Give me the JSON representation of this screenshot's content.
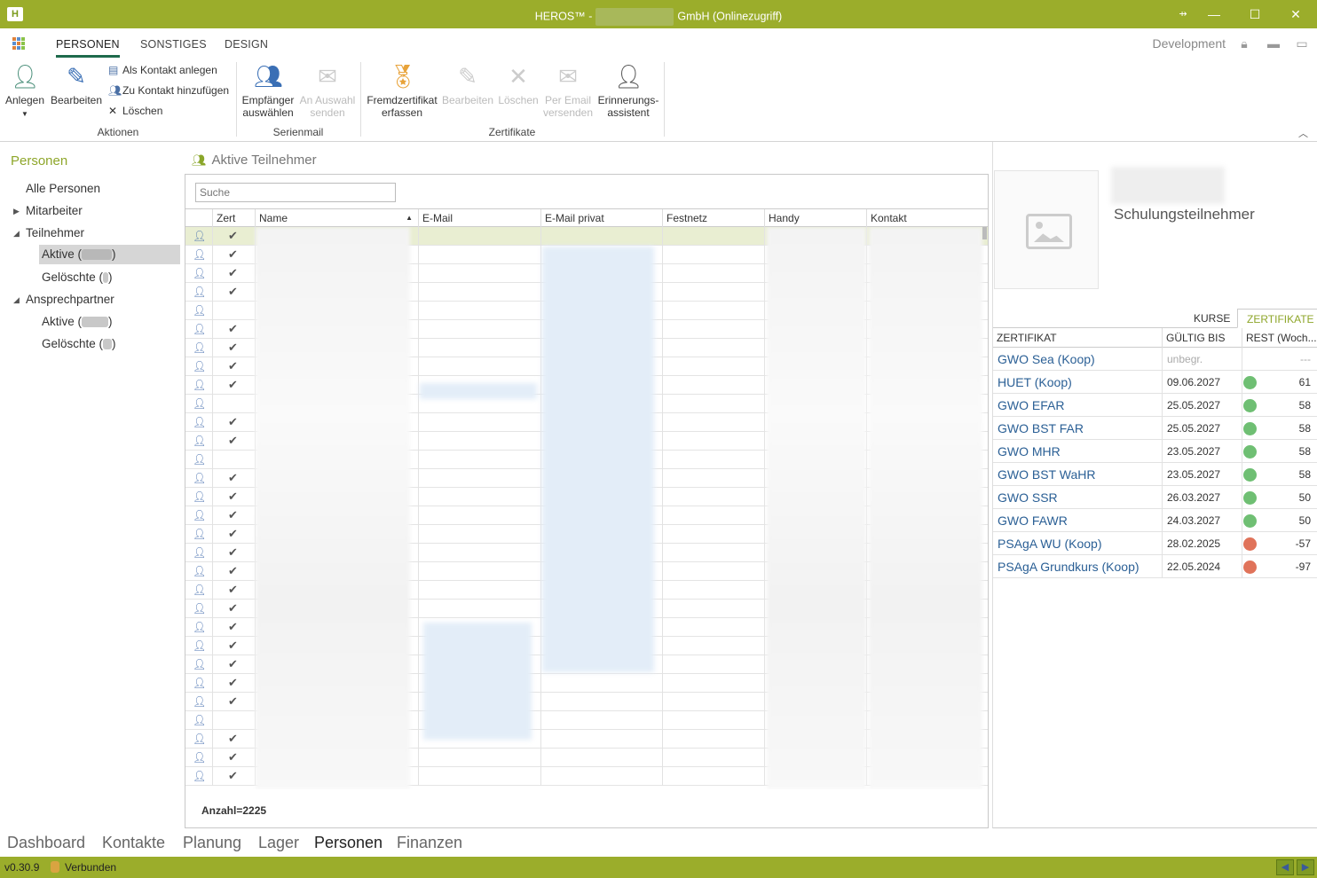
{
  "window": {
    "title_left": "HEROS™ -",
    "title_right": "GmbH (Onlinezugriff)",
    "logo": "H",
    "pin": "⇸",
    "min": "—",
    "max": "☐",
    "close": "✕"
  },
  "tabs": [
    "PERSONEN",
    "SONSTIGES",
    "DESIGN"
  ],
  "topright": {
    "env": "Development"
  },
  "ribbon": {
    "anlegen": "Anlegen",
    "bearbeiten": "Bearbeiten",
    "als_kontakt": "Als Kontakt anlegen",
    "zu_kontakt": "Zu Kontakt hinzufügen",
    "loeschen": "Löschen",
    "group_aktionen": "Aktionen",
    "empf1": "Empfänger",
    "empf2": "auswählen",
    "an1": "An Auswahl",
    "an2": "senden",
    "group_serienmail": "Serienmail",
    "fremd1": "Fremdzertifikat",
    "fremd2": "erfassen",
    "z_bearbeiten": "Bearbeiten",
    "z_loeschen": "Löschen",
    "mail1": "Per Email",
    "mail2": "versenden",
    "erin1": "Erinnerungs-",
    "erin2": "assistent",
    "group_zertifikate": "Zertifikate"
  },
  "sidebar": {
    "heading": "Personen",
    "items": [
      {
        "label": "Alle Personen"
      },
      {
        "label": "Mitarbeiter"
      },
      {
        "label": "Teilnehmer"
      },
      {
        "label": "Aktive ("
      },
      {
        "label": "Gelöschte ("
      },
      {
        "label": "Ansprechpartner"
      },
      {
        "label": "Aktive ("
      },
      {
        "label": "Gelöschte ("
      }
    ],
    "close_paren": ")"
  },
  "main": {
    "title": "Aktive Teilnehmer",
    "search_placeholder": "Suche",
    "columns": [
      "Zert",
      "Name",
      "E-Mail",
      "E-Mail privat",
      "Festnetz",
      "Handy",
      "Kontakt"
    ],
    "count": "Anzahl=2225",
    "zert": [
      1,
      1,
      1,
      1,
      0,
      1,
      1,
      1,
      1,
      0,
      1,
      1,
      0,
      1,
      1,
      1,
      1,
      1,
      1,
      1,
      1,
      1,
      1,
      1,
      1,
      1,
      0,
      1,
      1,
      1
    ]
  },
  "right": {
    "role": "Schulungsteilnehmer",
    "tabs": [
      "KURSE",
      "ZERTIFIKATE"
    ],
    "headers": [
      "ZERTIFIKAT",
      "GÜLTIG BIS",
      "REST (Woch..."
    ],
    "certs": [
      {
        "name": "GWO Sea (Koop)",
        "date": "unbegr.",
        "rest": "---",
        "status": "none"
      },
      {
        "name": "HUET (Koop)",
        "date": "09.06.2027",
        "rest": "61",
        "status": "green"
      },
      {
        "name": "GWO EFAR",
        "date": "25.05.2027",
        "rest": "58",
        "status": "green"
      },
      {
        "name": "GWO BST FAR",
        "date": "25.05.2027",
        "rest": "58",
        "status": "green"
      },
      {
        "name": "GWO MHR",
        "date": "23.05.2027",
        "rest": "58",
        "status": "green"
      },
      {
        "name": "GWO BST WaHR",
        "date": "23.05.2027",
        "rest": "58",
        "status": "green"
      },
      {
        "name": "GWO SSR",
        "date": "26.03.2027",
        "rest": "50",
        "status": "green"
      },
      {
        "name": "GWO FAWR",
        "date": "24.03.2027",
        "rest": "50",
        "status": "green"
      },
      {
        "name": "PSAgA WU (Koop)",
        "date": "28.02.2025",
        "rest": "-57",
        "status": "red"
      },
      {
        "name": "PSAgA Grundkurs (Koop)",
        "date": "22.05.2024",
        "rest": "-97",
        "status": "red"
      }
    ],
    "colors": {
      "green": "#6fbf73",
      "red": "#e0735a"
    }
  },
  "bottomnav": [
    "Dashboard",
    "Kontakte",
    "Planung",
    "Lager",
    "Personen",
    "Finanzen"
  ],
  "status": {
    "version": "v0.30.9",
    "connection": "Verbunden"
  }
}
